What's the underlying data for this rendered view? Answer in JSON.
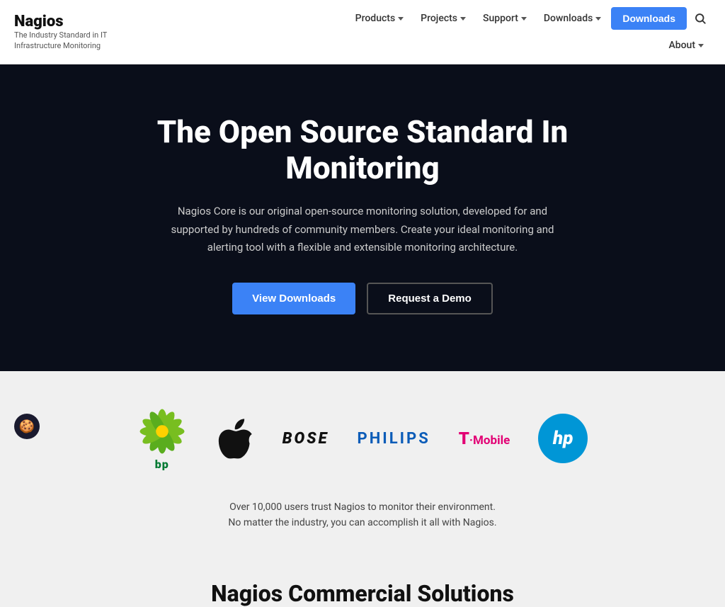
{
  "header": {
    "logo": {
      "name": "Nagios",
      "tagline": "The Industry Standard in IT Infrastructure Monitoring"
    },
    "nav": {
      "row1": [
        {
          "label": "Products",
          "hasDropdown": true
        },
        {
          "label": "Projects",
          "hasDropdown": true
        },
        {
          "label": "Support",
          "hasDropdown": true
        },
        {
          "label": "Downloads",
          "hasDropdown": true
        }
      ],
      "row2": [
        {
          "label": "About",
          "hasDropdown": true
        }
      ],
      "downloads_button": "Downloads"
    }
  },
  "hero": {
    "title": "The Open Source Standard In Monitoring",
    "description": "Nagios Core is our original open-source monitoring solution, developed for and supported by hundreds of community members. Create your ideal monitoring and alerting tool with a flexible and extensible monitoring architecture.",
    "btn_primary": "View Downloads",
    "btn_secondary": "Request a Demo"
  },
  "logos": {
    "items": [
      {
        "name": "bp",
        "type": "bp"
      },
      {
        "name": "Apple",
        "type": "apple"
      },
      {
        "name": "BOSE",
        "type": "bose"
      },
      {
        "name": "PHILIPS",
        "type": "philips"
      },
      {
        "name": "T-Mobile",
        "type": "tmobile"
      },
      {
        "name": "HP",
        "type": "hp"
      }
    ],
    "trust_text": "Over 10,000 users trust Nagios to monitor their environment. No matter the industry, you can accomplish it all with Nagios."
  },
  "commercial": {
    "title": "Nagios Commercial Solutions"
  },
  "cookie": {
    "label": "Cookie settings"
  }
}
